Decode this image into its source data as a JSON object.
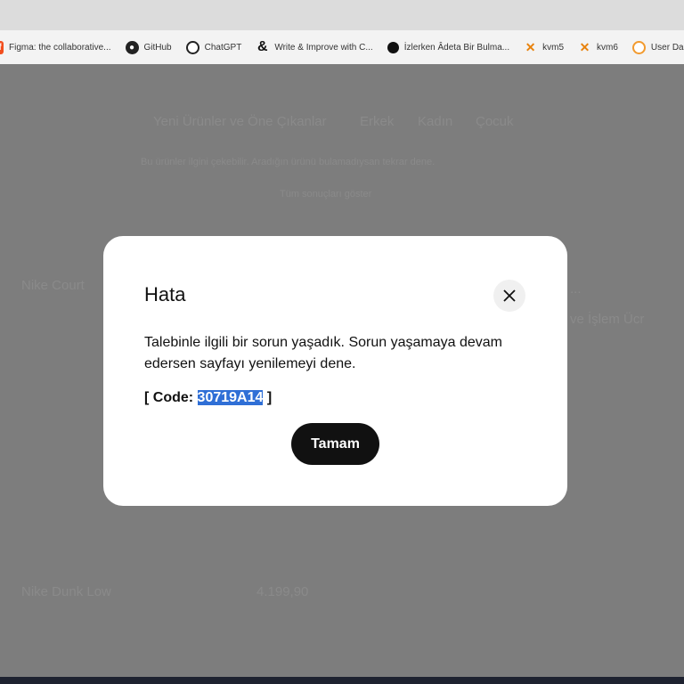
{
  "bookmarks": [
    {
      "label": "Figma: the collaborative...",
      "icon": "figma-icon",
      "color": "#f24e1e"
    },
    {
      "label": "GitHub",
      "icon": "github-icon",
      "color": "#222222"
    },
    {
      "label": "ChatGPT",
      "icon": "chatgpt-icon",
      "color": "#222222"
    },
    {
      "label": "Write & Improve with C...",
      "icon": "ampersand-icon",
      "color": "#111111"
    },
    {
      "label": "İzlerken Âdeta Bir Bulma...",
      "icon": "speech-bubble-icon",
      "color": "#111111"
    },
    {
      "label": "kvm5",
      "icon": "kvm-x-icon",
      "color": "#e8820c"
    },
    {
      "label": "kvm6",
      "icon": "kvm-x-icon",
      "color": "#e8820c"
    },
    {
      "label": "User Dash",
      "icon": "dashboard-icon",
      "color": "#f29a2e"
    }
  ],
  "background": {
    "nav": [
      "Yeni Ürünler ve Öne Çıkanlar",
      "Erkek",
      "Kadın",
      "Çocuk"
    ],
    "line1": "Bu ürünler ilgini çekebilir. Aradığın ürünü bulamadıysan tekrar dene.",
    "line2": "Tüm sonuçları göster",
    "product1": "Nike Court",
    "product2": "Nike Dunk Low",
    "price": "4.199,90",
    "right_label": "...",
    "right_text": "ve İşlem Ücr"
  },
  "modal": {
    "title": "Hata",
    "message": "Talebinle ilgili bir sorun yaşadık. Sorun yaşamaya devam edersen sayfayı yenilemeyi dene.",
    "code_prefix": "[ Code: ",
    "code_value": "30719A14",
    "code_suffix": " ]",
    "ok_label": "Tamam"
  },
  "colors": {
    "overlay": "#7d7d7d",
    "button": "#111111",
    "highlight": "#2f6fd6"
  }
}
